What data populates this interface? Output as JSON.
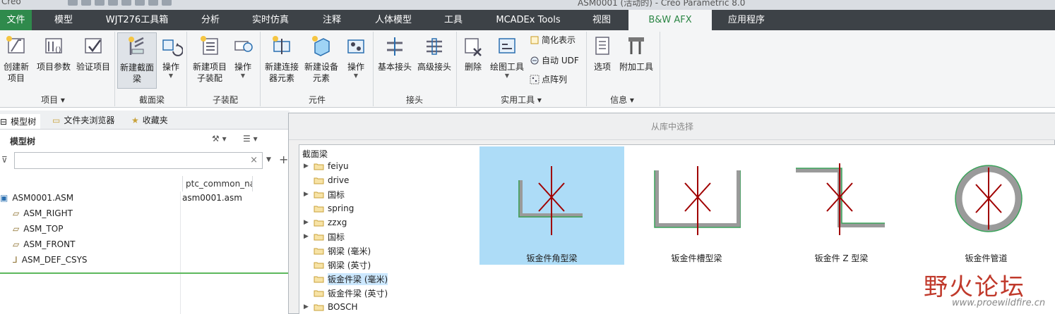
{
  "titlebar": {
    "app": "Creo",
    "window_title": "ASM0001 (活动的) - Creo Parametric 8.0"
  },
  "menu": {
    "tabs": [
      "文件",
      "模型",
      "WJT276工具箱",
      "分析",
      "实时仿真",
      "注释",
      "人体模型",
      "工具",
      "MCADEx Tools",
      "视图",
      "B&W AFX",
      "应用程序"
    ],
    "active": "B&W AFX"
  },
  "ribbon": {
    "project": {
      "new": "创建新项目",
      "params": "项目参数",
      "verify": "验证项目",
      "group": "项目 ▾"
    },
    "beam": {
      "new_beam": "新建截面梁",
      "ops": "操作",
      "group": "截面梁"
    },
    "subasm": {
      "new_sub": "新建项目子装配",
      "ops": "操作",
      "group": "子装配"
    },
    "elements": {
      "new_conn": "新建连接器元素",
      "new_dev": "新建设备元素",
      "ops": "操作",
      "group": "元件"
    },
    "joints": {
      "basic": "基本接头",
      "advanced": "高级接头",
      "group": "接头"
    },
    "utility": {
      "delete": "删除",
      "draw": "绘图工具",
      "simplified": "简化表示",
      "auto_udf": "自动 UDF",
      "point_array": "点阵列",
      "group": "实用工具 ▾"
    },
    "info": {
      "options": "选项",
      "addon": "附加工具",
      "group": "信息 ▾"
    }
  },
  "left_panel": {
    "tabs": [
      "模型树",
      "文件夹浏览器",
      "收藏夹"
    ],
    "tree_header": "模型树",
    "filter_placeholder": "",
    "column": "ptc_common_na",
    "rows": [
      {
        "name": "ASM0001.ASM",
        "value": "asm0001.asm"
      },
      {
        "name": "ASM_RIGHT",
        "value": ""
      },
      {
        "name": "ASM_TOP",
        "value": ""
      },
      {
        "name": "ASM_FRONT",
        "value": ""
      },
      {
        "name": "ASM_DEF_CSYS",
        "value": ""
      }
    ]
  },
  "dialog": {
    "title": "从库中选择",
    "tree_root": "截面梁",
    "folders": [
      {
        "name": "feiyu",
        "expandable": true,
        "selected": false
      },
      {
        "name": "drive",
        "expandable": false,
        "selected": false
      },
      {
        "name": "国标",
        "expandable": true,
        "selected": false
      },
      {
        "name": "spring",
        "expandable": false,
        "selected": false
      },
      {
        "name": "zzxg",
        "expandable": true,
        "selected": false
      },
      {
        "name": "国标",
        "expandable": true,
        "selected": false
      },
      {
        "name": "钢梁 (毫米)",
        "expandable": false,
        "selected": false
      },
      {
        "name": "钢梁 (英寸)",
        "expandable": false,
        "selected": false
      },
      {
        "name": "钣金件梁 (毫米)",
        "expandable": false,
        "selected": true
      },
      {
        "name": "钣金件梁 (英寸)",
        "expandable": false,
        "selected": false
      },
      {
        "name": "BOSCH",
        "expandable": true,
        "selected": false
      }
    ],
    "items": [
      {
        "label": "钣金件角型梁",
        "shape": "angle",
        "selected": true
      },
      {
        "label": "钣金件槽型梁",
        "shape": "channel",
        "selected": false
      },
      {
        "label": "钣金件 Z 型梁",
        "shape": "zbeam",
        "selected": false
      },
      {
        "label": "钣金件管道",
        "shape": "tube",
        "selected": false
      }
    ]
  },
  "watermark": {
    "text": "野火论坛",
    "url": "www.proewildfire.cn"
  },
  "colors": {
    "accent": "#2c8645",
    "menubar": "#3d4247",
    "selection": "#addcf7",
    "beam_axis": "#a00000"
  }
}
